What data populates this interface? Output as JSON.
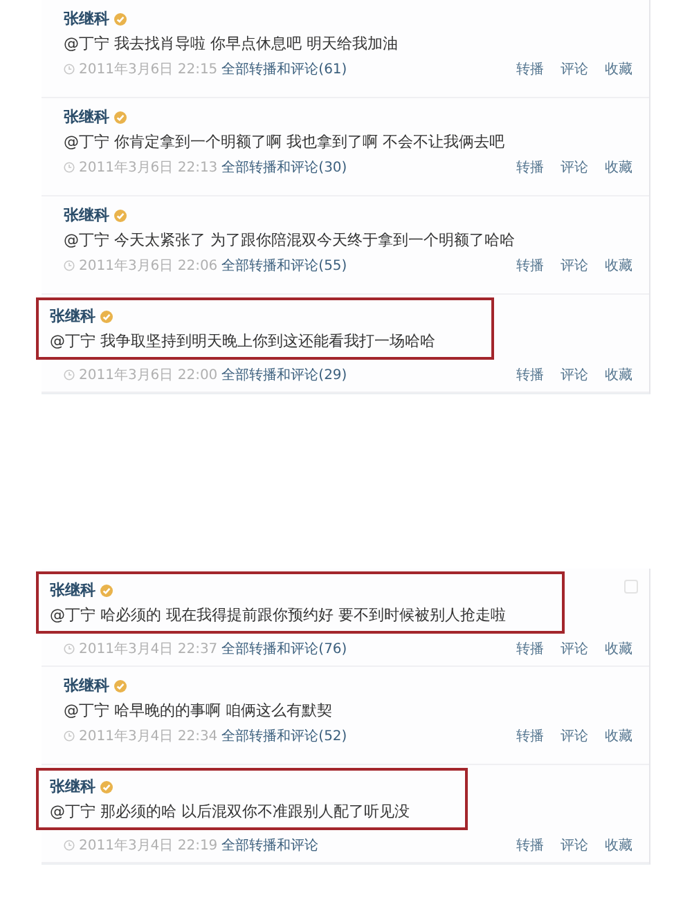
{
  "groups": [
    {
      "posts": [
        {
          "author": "张继科",
          "verified": true,
          "text": "@丁宁 我去找肖导啦 你早点休息吧 明天给我加油",
          "time": "2011年3月6日 22:15",
          "thread_link": "全部转播和评论(61)",
          "actions": [
            "转播",
            "评论",
            "收藏"
          ],
          "highlighted": false
        },
        {
          "author": "张继科",
          "verified": true,
          "text": "@丁宁 你肯定拿到一个明额了啊 我也拿到了啊 不会不让我俩去吧",
          "time": "2011年3月6日 22:13",
          "thread_link": "全部转播和评论(30)",
          "actions": [
            "转播",
            "评论",
            "收藏"
          ],
          "highlighted": false
        },
        {
          "author": "张继科",
          "verified": true,
          "text": "@丁宁 今天太紧张了 为了跟你陪混双今天终于拿到一个明额了哈哈",
          "time": "2011年3月6日 22:06",
          "thread_link": "全部转播和评论(55)",
          "actions": [
            "转播",
            "评论",
            "收藏"
          ],
          "highlighted": false
        },
        {
          "author": "张继科",
          "verified": true,
          "text": "@丁宁 我争取坚持到明天晚上你到这还能看我打一场哈哈",
          "time": "2011年3月6日 22:00",
          "thread_link": "全部转播和评论(29)",
          "actions": [
            "转播",
            "评论",
            "收藏"
          ],
          "highlighted": true
        }
      ]
    },
    {
      "posts": [
        {
          "author": "张继科",
          "verified": true,
          "text": "@丁宁 哈必须的 现在我得提前跟你预约好 要不到时候被别人抢走啦",
          "time": "2011年3月4日 22:37",
          "thread_link": "全部转播和评论(76)",
          "actions": [
            "转播",
            "评论",
            "收藏"
          ],
          "highlighted": true
        },
        {
          "author": "张继科",
          "verified": true,
          "text": "@丁宁 哈早晚的的事啊 咱俩这么有默契",
          "time": "2011年3月4日 22:34",
          "thread_link": "全部转播和评论(52)",
          "actions": [
            "转播",
            "评论",
            "收藏"
          ],
          "highlighted": false
        },
        {
          "author": "张继科",
          "verified": true,
          "text": "@丁宁 那必须的哈 以后混双你不准跟别人配了听见没",
          "time": "2011年3月4日 22:19",
          "thread_link": "全部转播和评论",
          "actions": [
            "转播",
            "评论",
            "收藏"
          ],
          "highlighted": true
        }
      ]
    }
  ]
}
